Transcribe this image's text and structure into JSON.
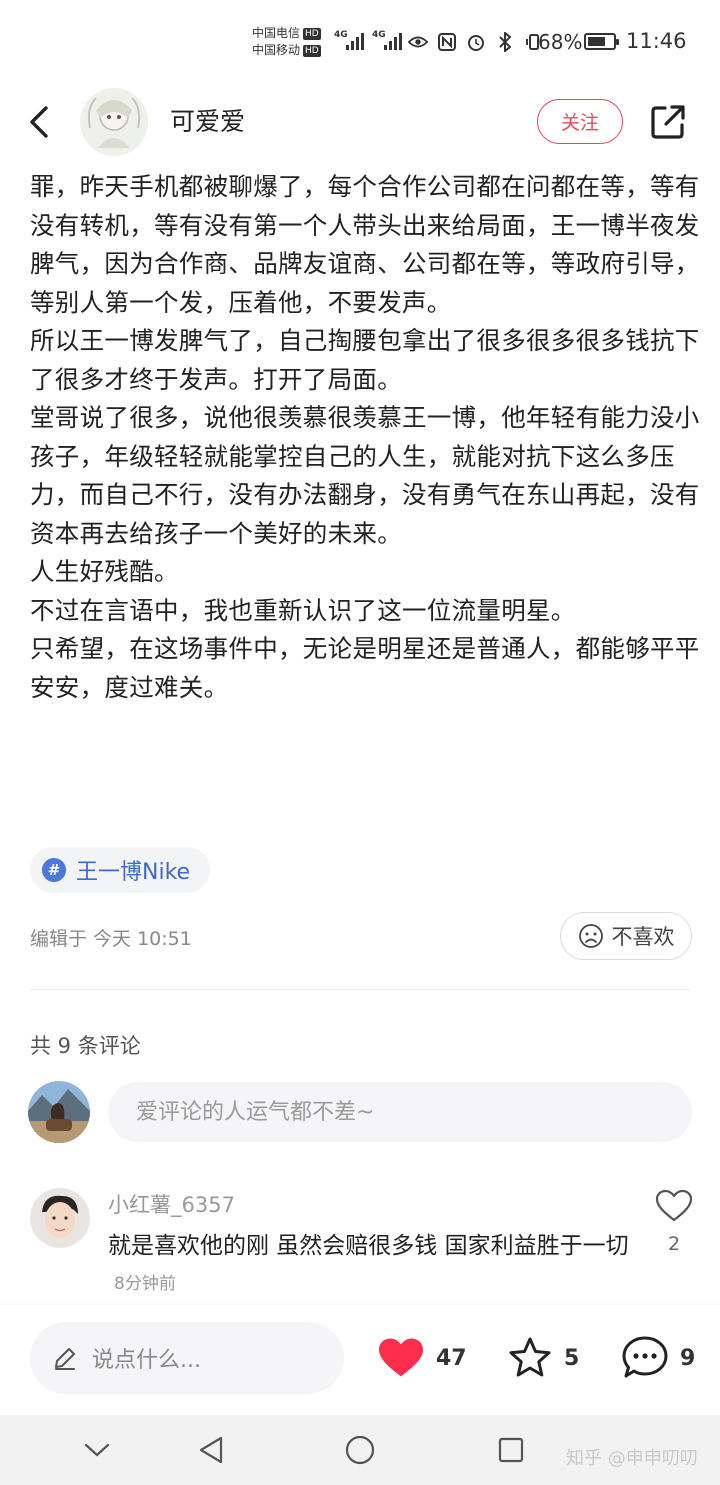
{
  "status_bar": {
    "carrier1": "中国电信",
    "carrier2": "中国移动",
    "hd": "HD",
    "net": "4G",
    "battery": "68%",
    "time": "11:46"
  },
  "header": {
    "author": "可爱爱",
    "follow_label": "关注",
    "icons": [
      "back-arrow-icon",
      "share-icon"
    ]
  },
  "article": {
    "paragraphs": [
      "罪，昨天手机都被聊爆了，每个合作公司都在问都在等，等有没有转机，等有没有第一个人带头出来给局面，王一博半夜发脾气，因为合作商、品牌友谊商、公司都在等，等政府引导，等别人第一个发，压着他，不要发声。",
      "所以王一博发脾气了，自己掏腰包拿出了很多很多很多钱抗下了很多才终于发声。打开了局面。",
      "堂哥说了很多，说他很羡慕很羡慕王一博，他年轻有能力没小孩子，年级轻轻就能掌控自己的人生，就能对抗下这么多压力，而自己不行，没有办法翻身，没有勇气在东山再起，没有资本再去给孩子一个美好的未来。",
      "人生好残酷。",
      "不过在言语中，我也重新认识了这一位流量明星。",
      "只希望，在这场事件中，无论是明星还是普通人，都能够平平安安，度过难关。"
    ],
    "topic": "王一博Nike",
    "edit_time": "编辑于 今天 10:51",
    "dislike_label": "不喜欢"
  },
  "comments": {
    "count_label": "共 9 条评论",
    "input_placeholder": "爱评论的人运气都不差~",
    "items": [
      {
        "user": "小红薯_6357",
        "text": "就是喜欢他的刚 虽然会赔很多钱 国家利益胜于一切",
        "time": "8分钟前",
        "likes": "2"
      }
    ]
  },
  "action_bar": {
    "say_placeholder": "说点什么...",
    "likes": "47",
    "stars": "5",
    "comments": "9",
    "like_color": "#ff2e4d"
  },
  "nav_bar": {
    "watermark": "知乎 @申申叨叨"
  }
}
